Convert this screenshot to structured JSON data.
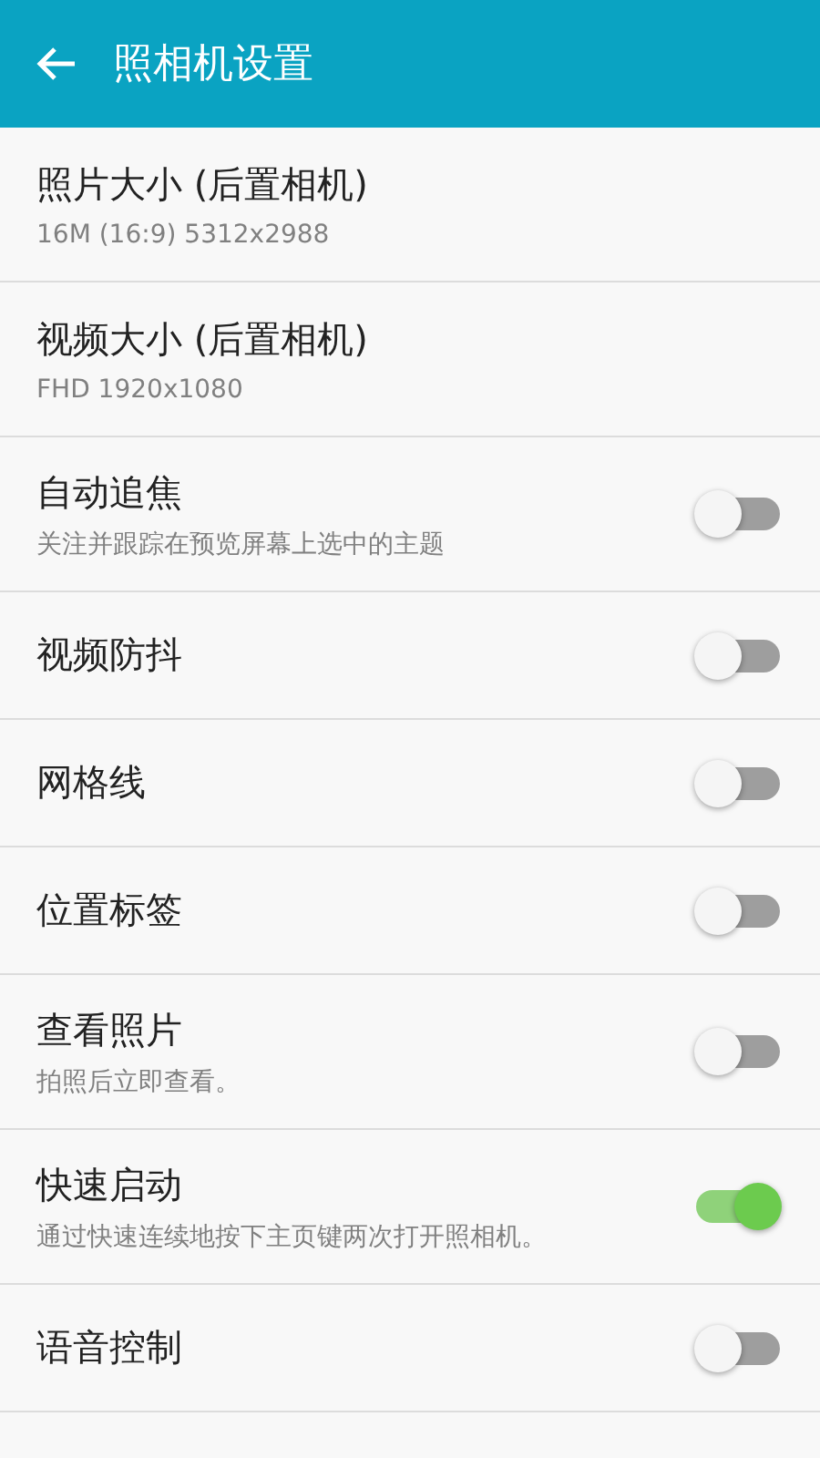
{
  "header": {
    "title": "照相机设置"
  },
  "settings": [
    {
      "kind": "value",
      "title": "照片大小 (后置相机)",
      "subtitle": "16M (16:9) 5312x2988"
    },
    {
      "kind": "value",
      "title": "视频大小 (后置相机)",
      "subtitle": "FHD 1920x1080"
    },
    {
      "kind": "toggle",
      "title": "自动追焦",
      "subtitle": "关注并跟踪在预览屏幕上选中的主题",
      "on": false
    },
    {
      "kind": "toggle",
      "title": "视频防抖",
      "on": false
    },
    {
      "kind": "toggle",
      "title": "网格线",
      "on": false
    },
    {
      "kind": "toggle",
      "title": "位置标签",
      "on": false
    },
    {
      "kind": "toggle",
      "title": "查看照片",
      "subtitle": "拍照后立即查看。",
      "on": false
    },
    {
      "kind": "toggle",
      "title": "快速启动",
      "subtitle": "通过快速连续地按下主页键两次打开照相机。",
      "on": true
    },
    {
      "kind": "toggle",
      "title": "语音控制",
      "on": false
    }
  ]
}
